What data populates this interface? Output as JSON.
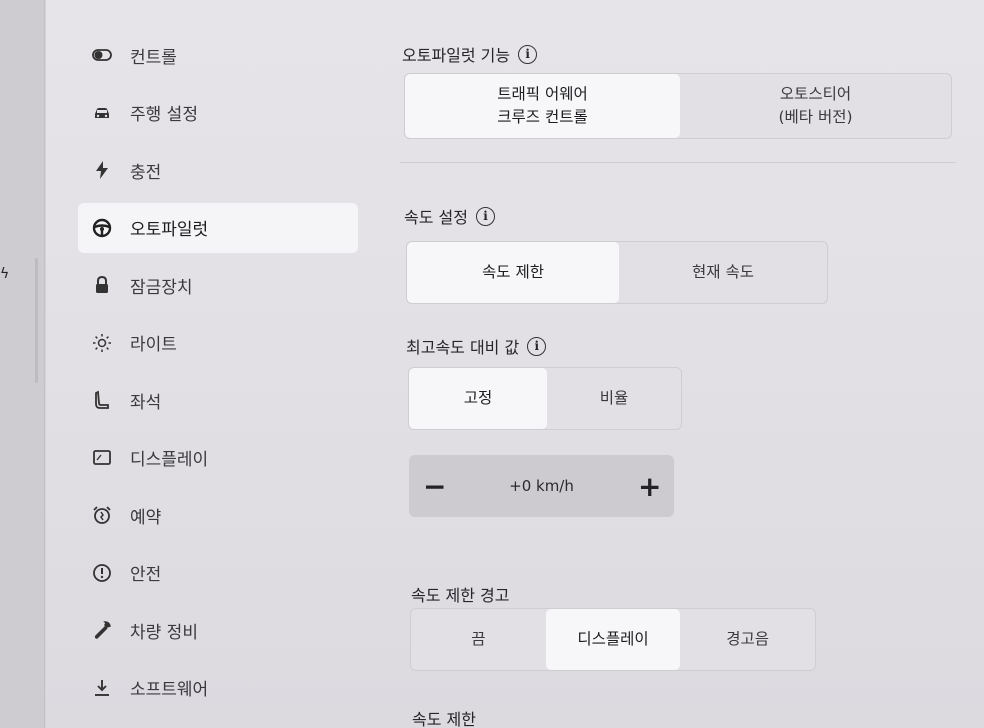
{
  "sidebar": {
    "items": [
      {
        "label": "컨트롤",
        "icon": "toggle-icon"
      },
      {
        "label": "주행 설정",
        "icon": "car-icon"
      },
      {
        "label": "충전",
        "icon": "lightning-icon"
      },
      {
        "label": "오토파일럿",
        "icon": "steering-wheel-icon"
      },
      {
        "label": "잠금장치",
        "icon": "lock-icon"
      },
      {
        "label": "라이트",
        "icon": "sun-icon"
      },
      {
        "label": "좌석",
        "icon": "seat-icon"
      },
      {
        "label": "디스플레이",
        "icon": "display-icon"
      },
      {
        "label": "예약",
        "icon": "alarm-clock-icon"
      },
      {
        "label": "안전",
        "icon": "alert-circle-icon"
      },
      {
        "label": "차량 정비",
        "icon": "wrench-icon"
      },
      {
        "label": "소프트웨어",
        "icon": "download-icon"
      }
    ],
    "active_index": 3
  },
  "autopilot": {
    "title": "오토파일럿 기능",
    "option_tacc_line1": "트래픽 어웨어",
    "option_tacc_line2": "크루즈 컨트롤",
    "option_autosteer_line1": "오토스티어",
    "option_autosteer_line2": "(베타 버전)",
    "selected": "트래픽 어웨어 크루즈 컨트롤"
  },
  "speed_setting": {
    "title": "속도 설정",
    "options": [
      "속도 제한",
      "현재 속도"
    ],
    "selected": "속도 제한"
  },
  "offset": {
    "title": "최고속도 대비 값",
    "options": [
      "고정",
      "비율"
    ],
    "selected": "고정",
    "stepper_minus": "−",
    "stepper_value": "+0 km/h",
    "stepper_plus": "+"
  },
  "speed_warning": {
    "title": "속도 제한 경고",
    "options": [
      "끔",
      "디스플레이",
      "경고음"
    ],
    "selected": "디스플레이"
  },
  "speed_limit": {
    "title": "속도 제한"
  },
  "colors": {
    "selected_segment": "#f7f6f8",
    "background": "#e4e2e6"
  }
}
